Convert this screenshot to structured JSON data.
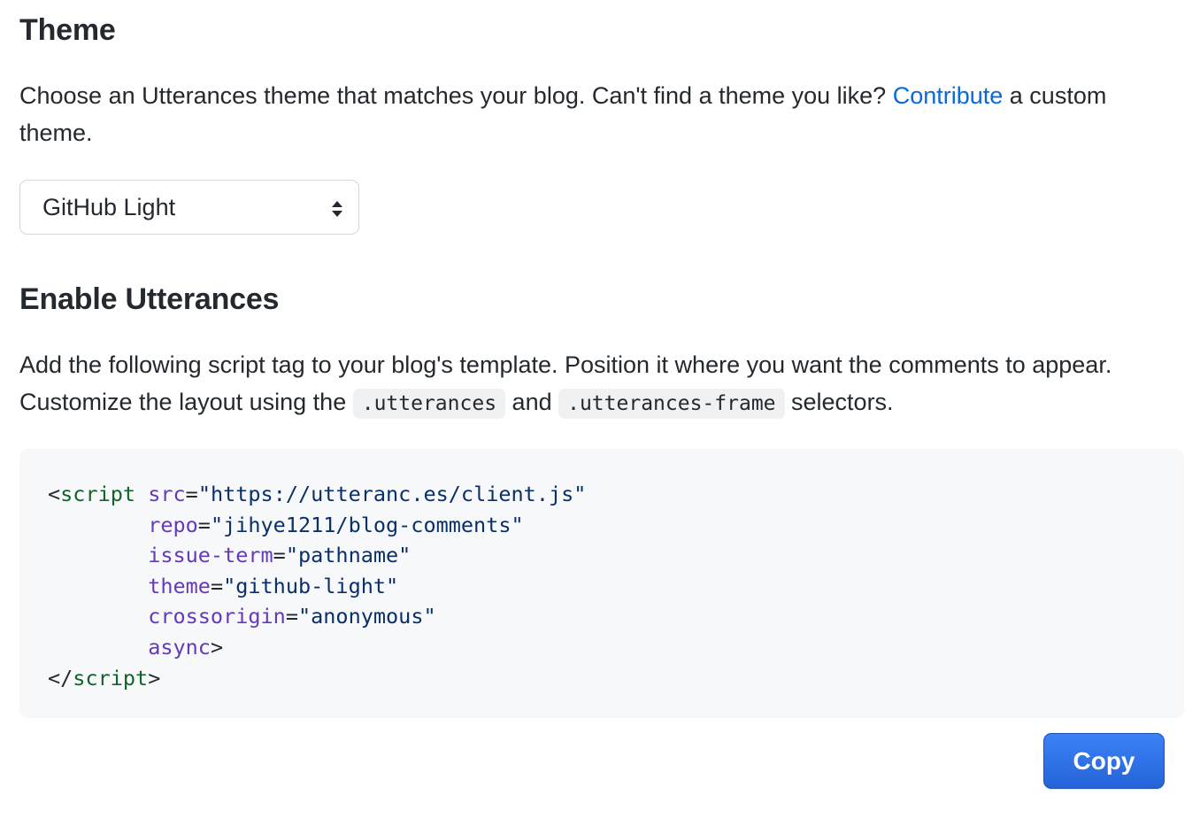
{
  "theme_section": {
    "title": "Theme",
    "description_before": "Choose an Utterances theme that matches your blog. Can't find a theme you like? ",
    "contribute_link": "Contribute",
    "description_after": " a custom theme.",
    "select": {
      "selected": "GitHub Light",
      "icon": "select-arrows-icon"
    }
  },
  "enable_section": {
    "title": "Enable Utterances",
    "description_part1": "Add the following script tag to your blog's template. Position it where you want the comments to appear. Customize the layout using the ",
    "code1": ".utterances",
    "description_part2": " and ",
    "code2": ".utterances-frame",
    "description_part3": " selectors."
  },
  "code_block": {
    "open_lt": "<",
    "tag": "script",
    "close_tag_open": "</",
    "end_gt": ">",
    "indent": "        ",
    "attrs": [
      {
        "name": "src",
        "value": "\"https://utteranc.es/client.js\""
      },
      {
        "name": "repo",
        "value": "\"jihye1211/blog-comments\""
      },
      {
        "name": "issue-term",
        "value": "\"pathname\""
      },
      {
        "name": "theme",
        "value": "\"github-light\""
      },
      {
        "name": "crossorigin",
        "value": "\"anonymous\""
      }
    ],
    "async_attr": "async"
  },
  "copy_button": {
    "label": "Copy"
  },
  "colors": {
    "link": "#0969da",
    "button": "#2a6fe0",
    "code_tag": "#116329",
    "code_attr": "#6639ba",
    "code_string": "#0a3069"
  }
}
